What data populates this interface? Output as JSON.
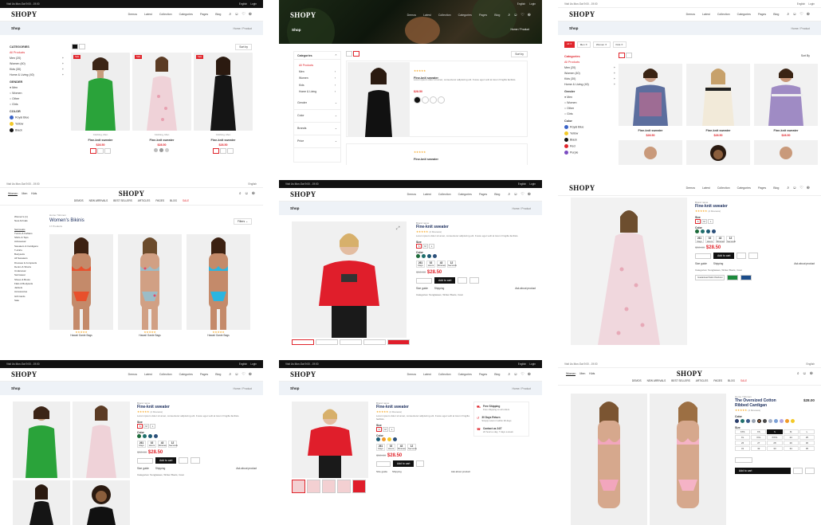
{
  "topbar": {
    "hours": "Visit Us Mon-Sat 9:00 - 19:00",
    "phone": "+91 123-457-6880",
    "lang": "English",
    "login": "Login"
  },
  "brand": "SHOPY",
  "nav": [
    "Demos",
    "Latest",
    "Collection",
    "Categories",
    "Pages",
    "Blog"
  ],
  "band": {
    "shop": "Shop",
    "product": "Shop",
    "crumb": "Home  /  Product"
  },
  "product": {
    "name": "Fine-knit sweater",
    "price": "$28.50",
    "old": "$30.00",
    "brand": "Brand name",
    "reviews": "(4 Reviews)",
    "desc": "Lorem ipsum dolor sit amet, consectetur adipiscing elit. Fusce eget velit at lorem fringilla facilisis.",
    "add": "Add to cart",
    "size_label": "Size",
    "color_label": "Color",
    "size_guide": "Size guide",
    "shipping": "Shipping",
    "ask": "Ask about product",
    "categories": "Categories: Sunglasses, Winter Boots, Coat",
    "countdown": [
      {
        "n": "261",
        "l": "Days"
      },
      {
        "n": "02",
        "l": "Hours"
      },
      {
        "n": "43",
        "l": "Minutes"
      },
      {
        "n": "12",
        "l": "Seconds"
      }
    ]
  },
  "tile1": {
    "sort": "Sort by",
    "categories": "CATEGORIES",
    "all": "All Products",
    "cats": [
      "Men (20)",
      "Women (40)",
      "Kids (30)",
      "Home & Living (40)"
    ],
    "gender": "GENDER",
    "genders": [
      "Men",
      "Women",
      "Other",
      "Girls"
    ],
    "color": "COLOR",
    "colors": [
      "Royal Blue",
      "Yellow",
      "Black"
    ],
    "card": {
      "title": "Fine-knit sweater",
      "price": "$28.50",
      "cat": "Clothing, Men"
    }
  },
  "tile2": {
    "cat_title": "Categories",
    "all": "All Products",
    "cats": [
      "Men",
      "Women",
      "Kids",
      "Home & Living"
    ],
    "filters": [
      "Gender",
      "Color",
      "Brands",
      "Price"
    ],
    "sort": "Sort by",
    "item": "Fine-knit sweater",
    "item_price": "$28.50"
  },
  "tile3": {
    "tag": "Sort By",
    "cat_title": "Categories",
    "all": "All Products",
    "cats": [
      "Men (20)",
      "Women (40)",
      "Kids (30)",
      "Home & Living (40)"
    ],
    "gender": "Gender",
    "genders": [
      "Men",
      "Women",
      "Other",
      "Girls"
    ],
    "color": "Color",
    "colors": [
      "Royal Blue",
      "Yellow",
      "Black",
      "Red",
      "Purple"
    ],
    "card": "Fine-knit sweater",
    "price": "$28.50"
  },
  "tile4": {
    "nav_left": [
      "Women",
      "Men",
      "Kids"
    ],
    "brand": "SHOPY",
    "menu": [
      "DEMOS",
      "NEW ARRIVALS",
      "BEST SELLERS",
      "ARTICLES",
      "PAGES",
      "BLOG",
      "SALE"
    ],
    "side_top": [
      "Women's (1)",
      "New Arrivals"
    ],
    "side": [
      "Swimsuits",
      "Tunics & Kaftans",
      "Shirts & Tops",
      "Activewear",
      "Sweaters & Cardigans",
      "T-shirts",
      "Bodysuits",
      "All Sweaters",
      "Dresses & Jumpsuits",
      "Denim & Shorts",
      "Underwear",
      "Swimwear",
      "Shoes & Boots",
      "Flats & Bodysuits",
      "Jackets",
      "Accessories",
      "Gift Cards",
      "Sale"
    ],
    "crumb": "Home  /  Women",
    "title": "Women's Bikinis",
    "count": "17 Products",
    "filters": "Filters",
    "card": "Hawaii Garde Bags"
  },
  "tile6": {
    "brand": "SHOPY",
    "trust": "Guaranteed Safe Checkout"
  },
  "tile8": {
    "ship": [
      {
        "t": "Free Shipping",
        "d": "Free shipping on all orders"
      },
      {
        "t": "30 Days Return",
        "d": "Simply return it within 30 days"
      },
      {
        "t": "Contact us 24/7",
        "d": "24 hours a day, 7 days a week"
      }
    ]
  },
  "tile9": {
    "nav_left": [
      "Women",
      "Men",
      "Kids"
    ],
    "brand": "SHOPY",
    "menu": [
      "DEMOS",
      "NEW ARRIVALS",
      "BEST SELLERS",
      "ARTICLES",
      "PAGES",
      "BLOG",
      "SALE"
    ],
    "crumb": "Home  /  Women",
    "title": "The Oversized Cotton Ribbed Cardigan",
    "price": "$28.00",
    "reviews": "(4 Reviews)",
    "color": "Color",
    "size": "Size",
    "sizes": [
      "XXS",
      "XS",
      "S",
      "M",
      "L",
      "XL",
      "XXL",
      "XXXL",
      "24",
      "25",
      "26",
      "27",
      "28",
      "29",
      "30",
      "31",
      "32",
      "33",
      "34",
      "35"
    ],
    "add": "Add to cart"
  }
}
